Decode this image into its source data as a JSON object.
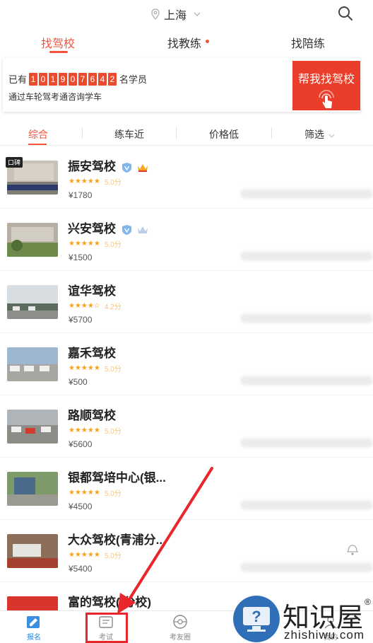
{
  "header": {
    "city": "上海",
    "pin_icon": "location-pin-icon",
    "search_icon": "search-icon"
  },
  "tabs": [
    {
      "label": "找驾校",
      "active": true
    },
    {
      "label": "找教练",
      "active": false,
      "has_dot": true
    },
    {
      "label": "找陪练",
      "active": false
    }
  ],
  "banner": {
    "prefix": "已有",
    "digits": [
      "1",
      "0",
      "1",
      "9",
      "0",
      "7",
      "6",
      "4",
      "2"
    ],
    "suffix": "名学员",
    "subtitle": "通过车轮驾考通咨询学车",
    "help_button": "帮我找驾校"
  },
  "filters": [
    {
      "label": "综合",
      "active": true
    },
    {
      "label": "练车近",
      "active": false
    },
    {
      "label": "价格低",
      "active": false
    },
    {
      "label": "筛选",
      "active": false,
      "dropdown": true
    }
  ],
  "schools": [
    {
      "name": "振安驾校",
      "stars": "★★★★★",
      "score": "5.0分",
      "price": "¥1780",
      "verified": true,
      "crown": "gold",
      "tag": "口碑"
    },
    {
      "name": "兴安驾校",
      "stars": "★★★★★",
      "score": "5.0分",
      "price": "¥1500",
      "verified": true,
      "crown": "silver"
    },
    {
      "name": "谊华驾校",
      "stars": "★★★★☆",
      "score": "4.2分",
      "price": "¥5700"
    },
    {
      "name": "嘉禾驾校",
      "stars": "★★★★★",
      "score": "5.0分",
      "price": "¥500"
    },
    {
      "name": "路顺驾校",
      "stars": "★★★★★",
      "score": "5.0分",
      "price": "¥5600"
    },
    {
      "name": "银都驾培中心(银...",
      "stars": "★★★★★",
      "score": "5.0分",
      "price": "¥4500"
    },
    {
      "name": "大众驾校(青浦分...",
      "stars": "★★★★★",
      "score": "5.0分",
      "price": "¥5400"
    },
    {
      "name": "富的驾校(   分校)",
      "stars": "",
      "score": "",
      "price": ""
    }
  ],
  "bottom_nav": [
    {
      "label": "报名",
      "icon": "signup-icon",
      "active": true
    },
    {
      "label": "考试",
      "icon": "exam-icon",
      "active": false
    },
    {
      "label": "考友圈",
      "icon": "steering-wheel-icon",
      "active": false
    },
    {
      "label": "",
      "icon": "help-icon",
      "active": false
    },
    {
      "label": "我的",
      "icon": "profile-icon",
      "active": false
    }
  ],
  "watermark": {
    "chinese": "知识屋",
    "english": "zhishiwu.com",
    "reg": "®"
  },
  "colors": {
    "accent": "#f2533a",
    "banner_red": "#ea3e2b",
    "nav_active": "#2a85e0",
    "annotation_red": "#e8262b"
  }
}
